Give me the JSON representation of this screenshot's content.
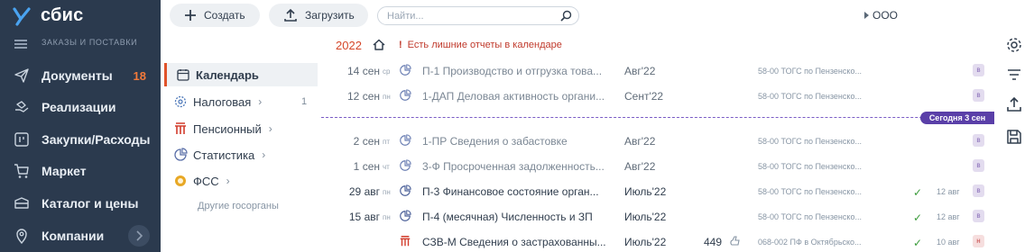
{
  "app": {
    "name": "сбис",
    "section_label": "ЗАКАЗЫ И ПОСТАВКИ"
  },
  "sidebar": {
    "items": [
      {
        "label": "Документы",
        "icon": "send-icon",
        "count": "18"
      },
      {
        "label": "Реализации",
        "icon": "hand-icon"
      },
      {
        "label": "Закупки/Расходы",
        "icon": "bracket-icon"
      },
      {
        "label": "Маркет",
        "icon": "cart-icon"
      },
      {
        "label": "Каталог и цены",
        "icon": "box-icon"
      },
      {
        "label": "Компании",
        "icon": "location-icon"
      }
    ]
  },
  "toolbar": {
    "create_label": "Создать",
    "upload_label": "Загрузить",
    "search_placeholder": "Найти...",
    "org_label": "ООО"
  },
  "calendar": {
    "year": "2022",
    "warning": "Есть лишние отчеты в календаре",
    "today_label": "Сегодня 3 сен"
  },
  "categories": {
    "items": [
      {
        "label": "Календарь",
        "icon": "calendar-icon",
        "active": true
      },
      {
        "label": "Налоговая",
        "icon": "tax-icon",
        "arrow": "›",
        "count": "1"
      },
      {
        "label": "Пенсионный",
        "icon": "pension-icon",
        "arrow": "›"
      },
      {
        "label": "Статистика",
        "icon": "stats-icon",
        "arrow": "›"
      },
      {
        "label": "ФСС",
        "icon": "fss-icon",
        "arrow": "›"
      }
    ],
    "other_label": "Другие госорганы"
  },
  "rows": [
    {
      "day": "14",
      "month": "сен",
      "dow": "ср",
      "agency_icon": "stats-icon",
      "title": "П-1 Производство и отгрузка това...",
      "period": "Авг'22",
      "office": "58-00 ТОГС по Пензенско...",
      "badge": "в",
      "muted": true
    },
    {
      "day": "12",
      "month": "сен",
      "dow": "пн",
      "agency_icon": "stats-icon",
      "title": "1-ДАП Деловая активность органи...",
      "period": "Сент'22",
      "office": "58-00 ТОГС по Пензенско...",
      "badge": "в",
      "muted": true
    },
    {
      "day": "2",
      "month": "сен",
      "dow": "пт",
      "agency_icon": "stats-icon",
      "title": "1-ПР Сведения о забастовке",
      "period": "Авг'22",
      "office": "58-00 ТОГС по Пензенско...",
      "badge": "в",
      "muted": true
    },
    {
      "day": "1",
      "month": "сен",
      "dow": "чт",
      "agency_icon": "stats-icon",
      "title": "3-Ф Просроченная задолженность...",
      "period": "Авг'22",
      "office": "58-00 ТОГС по Пензенско...",
      "badge": "в",
      "muted": true
    },
    {
      "day": "29",
      "month": "авг",
      "dow": "пн",
      "agency_icon": "stats-icon",
      "title": "П-3 Финансовое состояние орган...",
      "period": "Июль'22",
      "office": "58-00 ТОГС по Пензенско...",
      "check": "✓",
      "sent": "12 авг",
      "badge": "в"
    },
    {
      "day": "15",
      "month": "авг",
      "dow": "пн",
      "agency_icon": "stats-icon",
      "title": "П-4 (месячная) Численность и ЗП",
      "period": "Июль'22",
      "office": "58-00 ТОГС по Пензенско...",
      "check": "✓",
      "sent": "12 авг",
      "badge": "в"
    },
    {
      "agency_icon": "pension-icon",
      "title": "СЗВ-М Сведения о застрахованны...",
      "period": "Июль'22",
      "count": "449",
      "office": "068-002 ПФ в Октябрьско...",
      "check": "✓",
      "sent": "10 авг",
      "badge": "н",
      "badge_red": true
    }
  ],
  "colors": {
    "sidebar_bg": "#2b3a4e",
    "accent": "#e0532a",
    "today": "#5a3fa8",
    "ok": "#3a9b3a"
  }
}
